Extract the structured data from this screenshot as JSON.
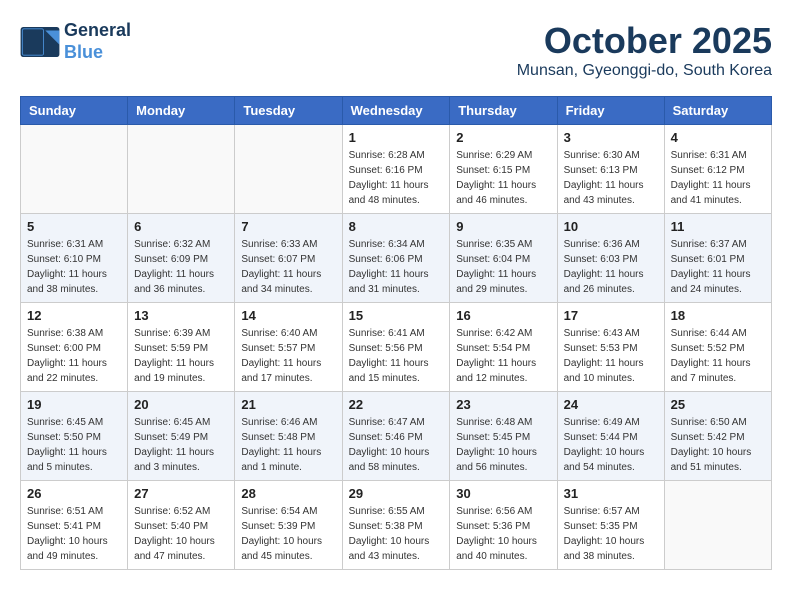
{
  "header": {
    "logo_line1": "General",
    "logo_line2": "Blue",
    "month": "October 2025",
    "location": "Munsan, Gyeonggi-do, South Korea"
  },
  "weekdays": [
    "Sunday",
    "Monday",
    "Tuesday",
    "Wednesday",
    "Thursday",
    "Friday",
    "Saturday"
  ],
  "weeks": [
    [
      {
        "day": "",
        "info": ""
      },
      {
        "day": "",
        "info": ""
      },
      {
        "day": "",
        "info": ""
      },
      {
        "day": "1",
        "info": "Sunrise: 6:28 AM\nSunset: 6:16 PM\nDaylight: 11 hours\nand 48 minutes."
      },
      {
        "day": "2",
        "info": "Sunrise: 6:29 AM\nSunset: 6:15 PM\nDaylight: 11 hours\nand 46 minutes."
      },
      {
        "day": "3",
        "info": "Sunrise: 6:30 AM\nSunset: 6:13 PM\nDaylight: 11 hours\nand 43 minutes."
      },
      {
        "day": "4",
        "info": "Sunrise: 6:31 AM\nSunset: 6:12 PM\nDaylight: 11 hours\nand 41 minutes."
      }
    ],
    [
      {
        "day": "5",
        "info": "Sunrise: 6:31 AM\nSunset: 6:10 PM\nDaylight: 11 hours\nand 38 minutes."
      },
      {
        "day": "6",
        "info": "Sunrise: 6:32 AM\nSunset: 6:09 PM\nDaylight: 11 hours\nand 36 minutes."
      },
      {
        "day": "7",
        "info": "Sunrise: 6:33 AM\nSunset: 6:07 PM\nDaylight: 11 hours\nand 34 minutes."
      },
      {
        "day": "8",
        "info": "Sunrise: 6:34 AM\nSunset: 6:06 PM\nDaylight: 11 hours\nand 31 minutes."
      },
      {
        "day": "9",
        "info": "Sunrise: 6:35 AM\nSunset: 6:04 PM\nDaylight: 11 hours\nand 29 minutes."
      },
      {
        "day": "10",
        "info": "Sunrise: 6:36 AM\nSunset: 6:03 PM\nDaylight: 11 hours\nand 26 minutes."
      },
      {
        "day": "11",
        "info": "Sunrise: 6:37 AM\nSunset: 6:01 PM\nDaylight: 11 hours\nand 24 minutes."
      }
    ],
    [
      {
        "day": "12",
        "info": "Sunrise: 6:38 AM\nSunset: 6:00 PM\nDaylight: 11 hours\nand 22 minutes."
      },
      {
        "day": "13",
        "info": "Sunrise: 6:39 AM\nSunset: 5:59 PM\nDaylight: 11 hours\nand 19 minutes."
      },
      {
        "day": "14",
        "info": "Sunrise: 6:40 AM\nSunset: 5:57 PM\nDaylight: 11 hours\nand 17 minutes."
      },
      {
        "day": "15",
        "info": "Sunrise: 6:41 AM\nSunset: 5:56 PM\nDaylight: 11 hours\nand 15 minutes."
      },
      {
        "day": "16",
        "info": "Sunrise: 6:42 AM\nSunset: 5:54 PM\nDaylight: 11 hours\nand 12 minutes."
      },
      {
        "day": "17",
        "info": "Sunrise: 6:43 AM\nSunset: 5:53 PM\nDaylight: 11 hours\nand 10 minutes."
      },
      {
        "day": "18",
        "info": "Sunrise: 6:44 AM\nSunset: 5:52 PM\nDaylight: 11 hours\nand 7 minutes."
      }
    ],
    [
      {
        "day": "19",
        "info": "Sunrise: 6:45 AM\nSunset: 5:50 PM\nDaylight: 11 hours\nand 5 minutes."
      },
      {
        "day": "20",
        "info": "Sunrise: 6:45 AM\nSunset: 5:49 PM\nDaylight: 11 hours\nand 3 minutes."
      },
      {
        "day": "21",
        "info": "Sunrise: 6:46 AM\nSunset: 5:48 PM\nDaylight: 11 hours\nand 1 minute."
      },
      {
        "day": "22",
        "info": "Sunrise: 6:47 AM\nSunset: 5:46 PM\nDaylight: 10 hours\nand 58 minutes."
      },
      {
        "day": "23",
        "info": "Sunrise: 6:48 AM\nSunset: 5:45 PM\nDaylight: 10 hours\nand 56 minutes."
      },
      {
        "day": "24",
        "info": "Sunrise: 6:49 AM\nSunset: 5:44 PM\nDaylight: 10 hours\nand 54 minutes."
      },
      {
        "day": "25",
        "info": "Sunrise: 6:50 AM\nSunset: 5:42 PM\nDaylight: 10 hours\nand 51 minutes."
      }
    ],
    [
      {
        "day": "26",
        "info": "Sunrise: 6:51 AM\nSunset: 5:41 PM\nDaylight: 10 hours\nand 49 minutes."
      },
      {
        "day": "27",
        "info": "Sunrise: 6:52 AM\nSunset: 5:40 PM\nDaylight: 10 hours\nand 47 minutes."
      },
      {
        "day": "28",
        "info": "Sunrise: 6:54 AM\nSunset: 5:39 PM\nDaylight: 10 hours\nand 45 minutes."
      },
      {
        "day": "29",
        "info": "Sunrise: 6:55 AM\nSunset: 5:38 PM\nDaylight: 10 hours\nand 43 minutes."
      },
      {
        "day": "30",
        "info": "Sunrise: 6:56 AM\nSunset: 5:36 PM\nDaylight: 10 hours\nand 40 minutes."
      },
      {
        "day": "31",
        "info": "Sunrise: 6:57 AM\nSunset: 5:35 PM\nDaylight: 10 hours\nand 38 minutes."
      },
      {
        "day": "",
        "info": ""
      }
    ]
  ]
}
